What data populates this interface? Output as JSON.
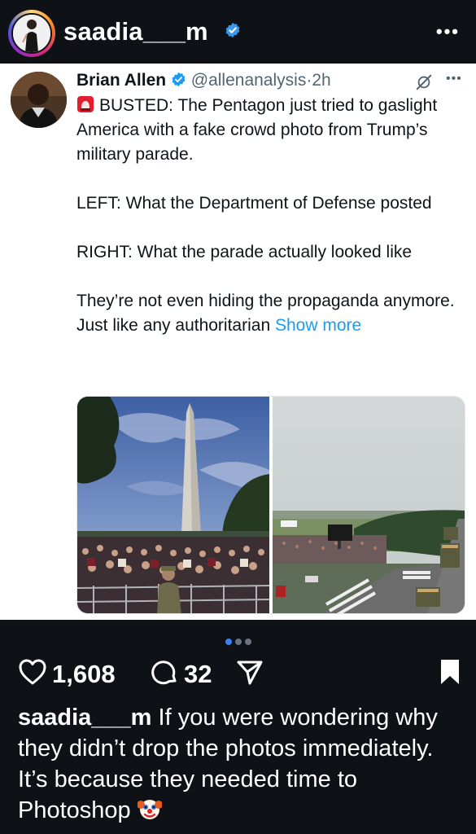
{
  "header": {
    "username": "saadia___m",
    "more_icon": "more-horizontal-icon"
  },
  "tweet": {
    "author_name": "Brian Allen",
    "author_handle": "@allenanalysis",
    "separator": "·",
    "time_ago": "2h",
    "paragraphs": [
      "BUSTED: The Pentagon just tried to gaslight America with a fake crowd photo from Trump’s military parade.",
      "LEFT: What the Department of Defense posted",
      "RIGHT: What the parade actually looked like"
    ],
    "last_paragraph": "They’re not even hiding the propaganda anymore. Just like any authoritarian",
    "show_more": "Show more",
    "colors": {
      "link": "#1d9bf0",
      "verified": "#1d9bf0",
      "text": "#0f1419",
      "muted": "#536471"
    }
  },
  "carousel": {
    "total": 3,
    "active_index": 0,
    "active_color": "#3b82f6",
    "inactive_color": "#6b7280"
  },
  "actions": {
    "likes": "1,608",
    "comments": "32"
  },
  "caption": {
    "username": "saadia___m",
    "text": "If you were wondering why they didn’t drop the photos immediately. It’s because they needed time to Photoshop",
    "emoji": "clown-face-emoji"
  }
}
